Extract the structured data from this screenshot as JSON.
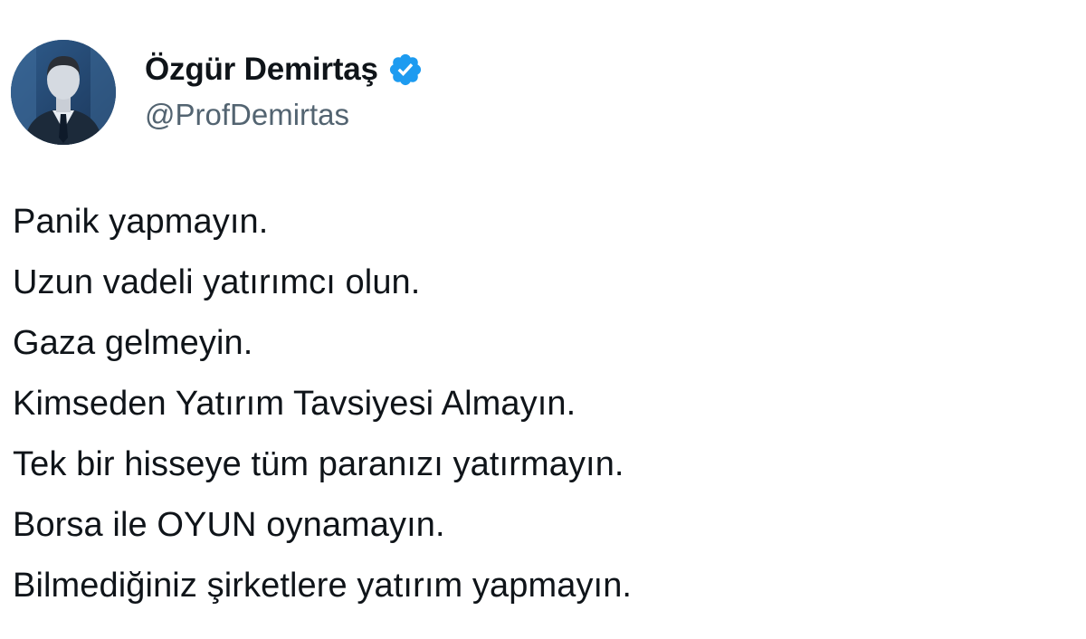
{
  "author": {
    "display_name": "Özgür Demirtaş",
    "handle": "@ProfDemirtas",
    "verified": true,
    "verified_color": "#1d9bf0",
    "avatar_icon": "profile-photo"
  },
  "tweet": {
    "lines": [
      "Panik yapmayın.",
      "Uzun vadeli yatırımcı olun.",
      "Gaza gelmeyin.",
      "Kimseden Yatırım Tavsiyesi Almayın.",
      "Tek bir hisseye tüm paranızı yatırmayın.",
      "Borsa ile OYUN oynamayın.",
      "Bilmediğiniz şirketlere yatırım yapmayın."
    ]
  },
  "colors": {
    "text": "#0f1419",
    "secondary_text": "#536471",
    "background": "#ffffff"
  }
}
